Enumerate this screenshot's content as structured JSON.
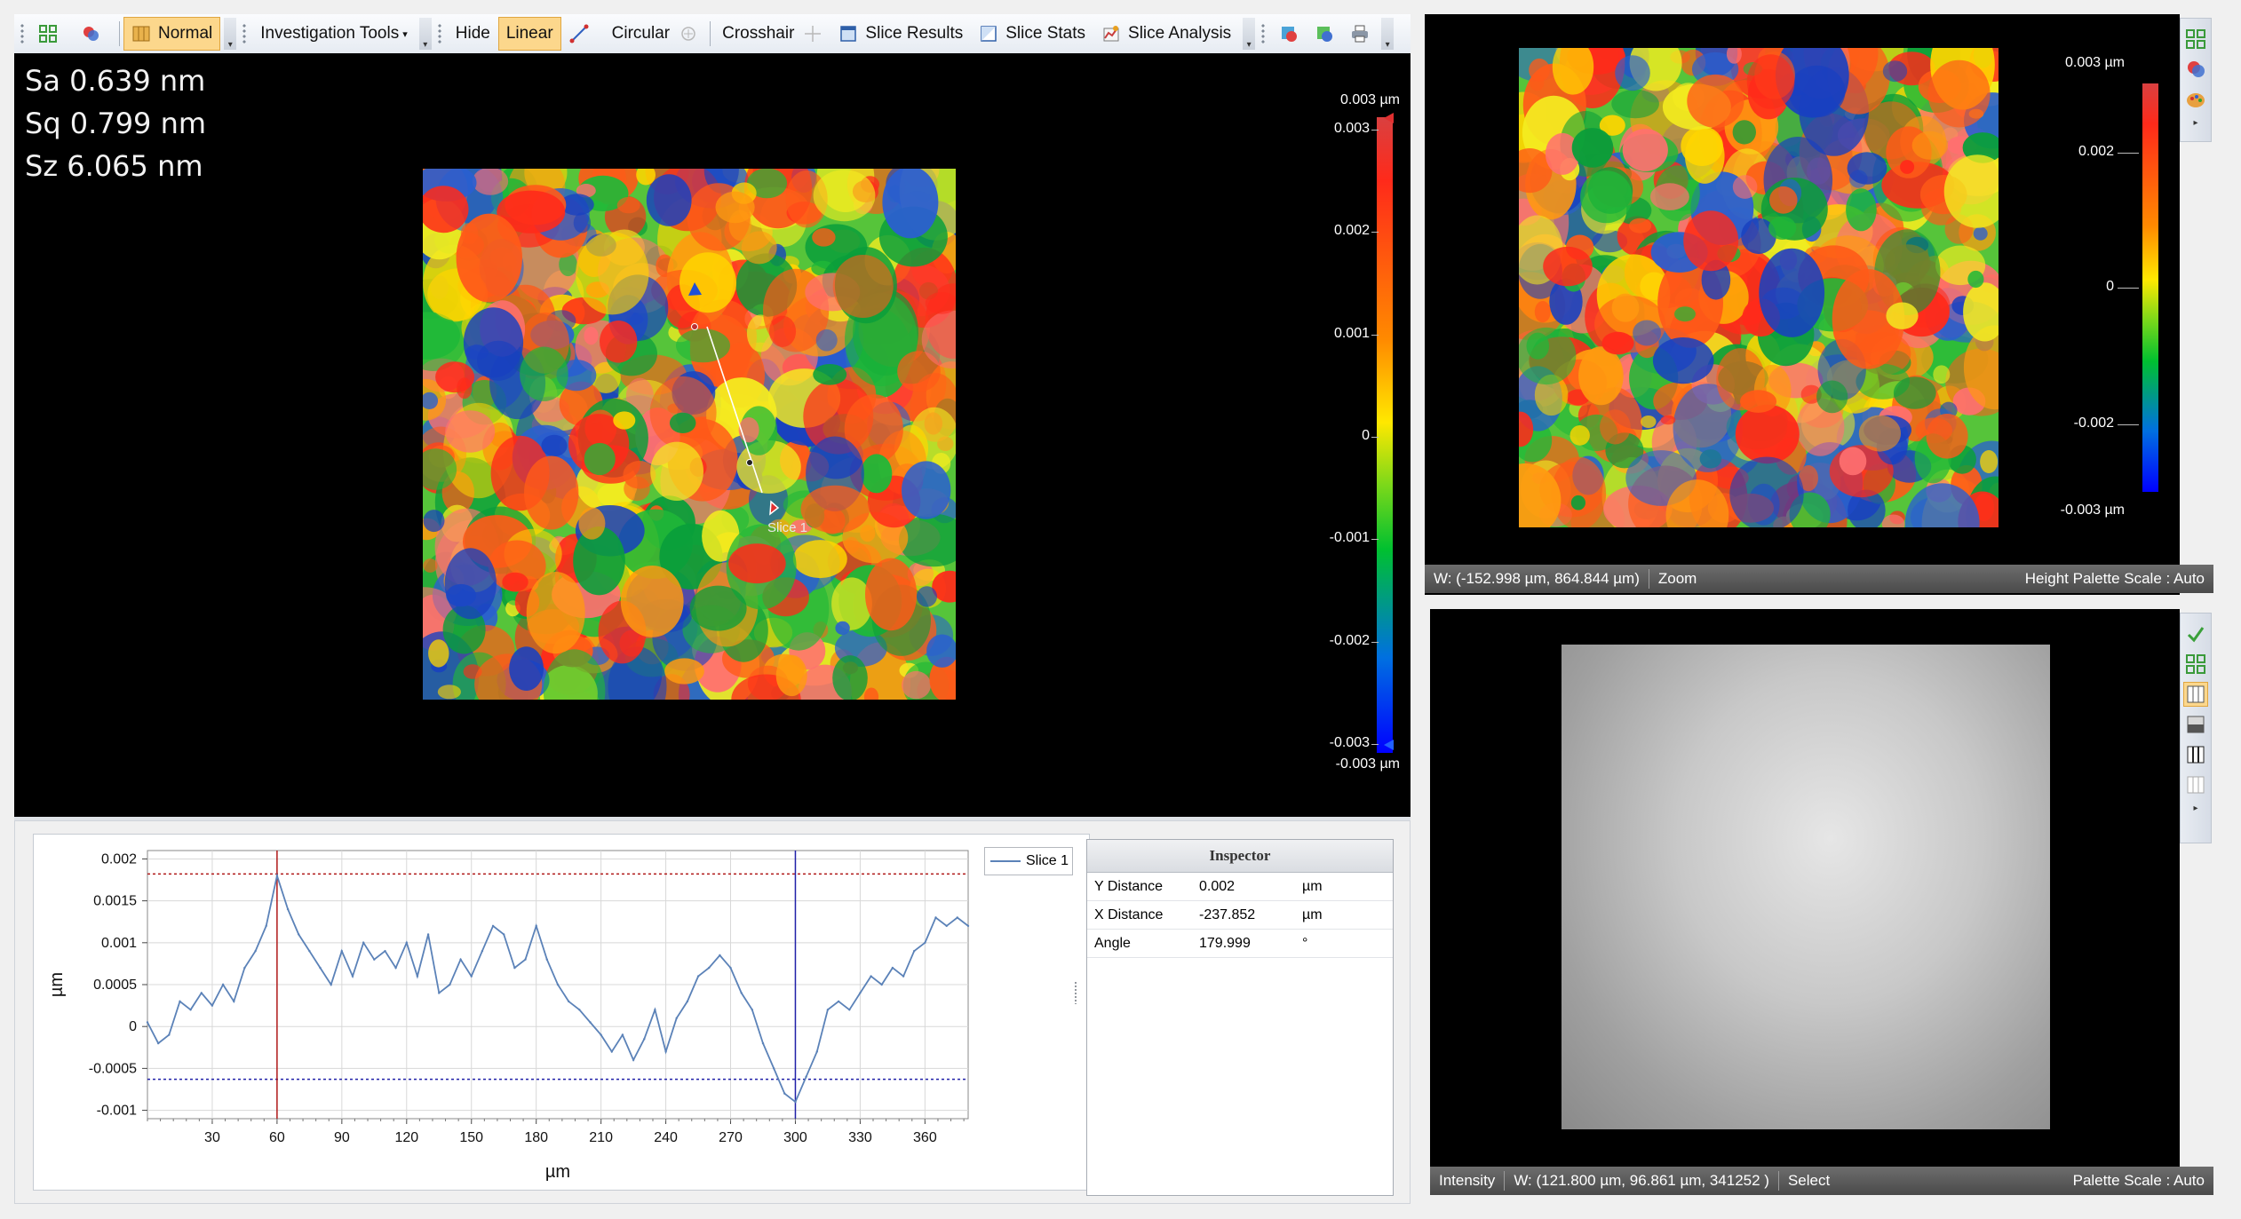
{
  "toolbar": {
    "normal_label": "Normal",
    "investigation_label": "Investigation Tools",
    "hide_label": "Hide",
    "linear_label": "Linear",
    "circular_label": "Circular",
    "crosshair_label": "Crosshair",
    "slice_results_label": "Slice Results",
    "slice_stats_label": "Slice Stats",
    "slice_analysis_label": "Slice Analysis"
  },
  "main_view": {
    "sa": "Sa 0.639 nm",
    "sq": "Sq 0.799 nm",
    "sz": "Sz 6.065 nm",
    "slice_label": "Slice 1",
    "colorbar": {
      "max_label": "0.003 µm",
      "min_label": "-0.003 µm",
      "ticks": [
        "0.003",
        "0.002",
        "0.001",
        "0",
        "-0.001",
        "-0.002",
        "-0.003"
      ]
    }
  },
  "height_panel": {
    "colorbar": {
      "max_label": "0.003 µm",
      "min_label": "-0.003 µm",
      "ticks": [
        "0.002",
        "0",
        "-0.002"
      ]
    },
    "status": {
      "w": "W: (-152.998 µm, 864.844 µm)",
      "mode": "Zoom",
      "palette": "Height Palette Scale : Auto"
    }
  },
  "intensity_panel": {
    "status": {
      "type": "Intensity",
      "w": "W: (121.800 µm, 96.861 µm, 341252 )",
      "mode": "Select",
      "palette": "Palette Scale : Auto"
    }
  },
  "inspector": {
    "title": "Inspector",
    "rows": [
      {
        "name": "Y Distance",
        "value": "0.002",
        "unit": "µm"
      },
      {
        "name": "X Distance",
        "value": "-237.852",
        "unit": "µm"
      },
      {
        "name": "Angle",
        "value": "179.999",
        "unit": "°"
      }
    ]
  },
  "chart_data": {
    "type": "line",
    "xlabel": "µm",
    "ylabel": "µm",
    "xlim": [
      0,
      380
    ],
    "ylim": [
      -0.0011,
      0.0021
    ],
    "x_ticks": [
      30,
      60,
      90,
      120,
      150,
      180,
      210,
      240,
      270,
      300,
      330,
      360
    ],
    "y_ticks": [
      0.002,
      0.0015,
      0.001,
      0.0005,
      0,
      -0.0005,
      -0.001
    ],
    "y_tick_labels": [
      "0.002",
      "0.0015",
      "0.001",
      "0.0005",
      "0",
      "-0.0005",
      "-0.001"
    ],
    "series": [
      {
        "name": "Slice 1",
        "color": "#5b82b8",
        "x": [
          0,
          5,
          10,
          15,
          20,
          25,
          30,
          35,
          40,
          45,
          50,
          55,
          60,
          65,
          70,
          75,
          80,
          85,
          90,
          95,
          100,
          105,
          110,
          115,
          120,
          125,
          130,
          135,
          140,
          145,
          150,
          155,
          160,
          165,
          170,
          175,
          180,
          185,
          190,
          195,
          200,
          205,
          210,
          215,
          220,
          225,
          230,
          235,
          240,
          245,
          250,
          255,
          260,
          265,
          270,
          275,
          280,
          285,
          290,
          295,
          300,
          305,
          310,
          315,
          320,
          325,
          330,
          335,
          340,
          345,
          350,
          355,
          360,
          365,
          370,
          375,
          380
        ],
        "y": [
          5e-05,
          -0.0002,
          -0.0001,
          0.0003,
          0.0002,
          0.0004,
          0.00025,
          0.0005,
          0.0003,
          0.0007,
          0.0009,
          0.0012,
          0.0018,
          0.0014,
          0.0011,
          0.0009,
          0.0007,
          0.0005,
          0.0009,
          0.0006,
          0.001,
          0.0008,
          0.0009,
          0.0007,
          0.001,
          0.0006,
          0.0011,
          0.0004,
          0.0005,
          0.0008,
          0.0006,
          0.0009,
          0.0012,
          0.0011,
          0.0007,
          0.0008,
          0.0012,
          0.0008,
          0.0005,
          0.0003,
          0.0002,
          5e-05,
          -0.0001,
          -0.0003,
          -0.0001,
          -0.0004,
          -0.00015,
          0.0002,
          -0.0003,
          0.0001,
          0.0003,
          0.0006,
          0.0007,
          0.00085,
          0.0007,
          0.0004,
          0.0002,
          -0.0002,
          -0.0005,
          -0.0008,
          -0.0009,
          -0.0006,
          -0.0003,
          0.0002,
          0.0003,
          0.0002,
          0.0004,
          0.0006,
          0.0005,
          0.0007,
          0.0006,
          0.0009,
          0.001,
          0.0013,
          0.0012,
          0.0013,
          0.0012
        ]
      }
    ],
    "cursor_lines": {
      "x_red": 60,
      "x_blue": 300,
      "y_red": 0.00182,
      "y_blue": -0.00063
    },
    "grid": true,
    "legend": "top-right"
  }
}
